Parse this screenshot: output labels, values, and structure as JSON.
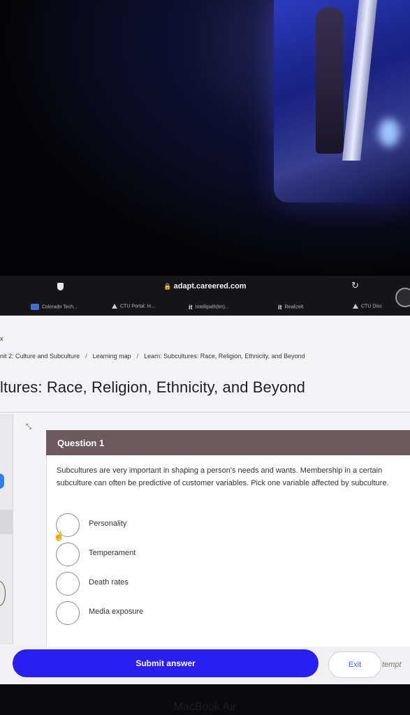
{
  "browser": {
    "url": "adapt.careered.com",
    "bookmarks": [
      {
        "label": "Colorado Tech...",
        "icon": "square"
      },
      {
        "label": "CTU Portal: In...",
        "icon": "triangle"
      },
      {
        "label": "Intellipath(tm)...",
        "icon": "it-logo"
      },
      {
        "label": "Realizeit",
        "icon": "it-logo"
      },
      {
        "label": "CTU Disc",
        "icon": "triangle"
      }
    ]
  },
  "page": {
    "close_label": "x",
    "breadcrumb": [
      "nit 2: Culture and Subculture",
      "Learning map",
      "Learn: Subcultures: Race, Religion, Ethnicity, and Beyond"
    ],
    "title": "ltures: Race, Religion, Ethnicity, and Beyond"
  },
  "question": {
    "header": "Question 1",
    "text": "Subcultures are very important in shaping a person's needs and wants. Membership in a certain subculture can often be predictive of customer variables. Pick one variable affected by subculture.",
    "options": [
      "Personality",
      "Temperament",
      "Death rates",
      "Media exposure"
    ]
  },
  "actions": {
    "submit": "Submit answer",
    "exit": "Exit",
    "attempt": "tempt"
  },
  "device": {
    "brand": "MacBook Air"
  }
}
